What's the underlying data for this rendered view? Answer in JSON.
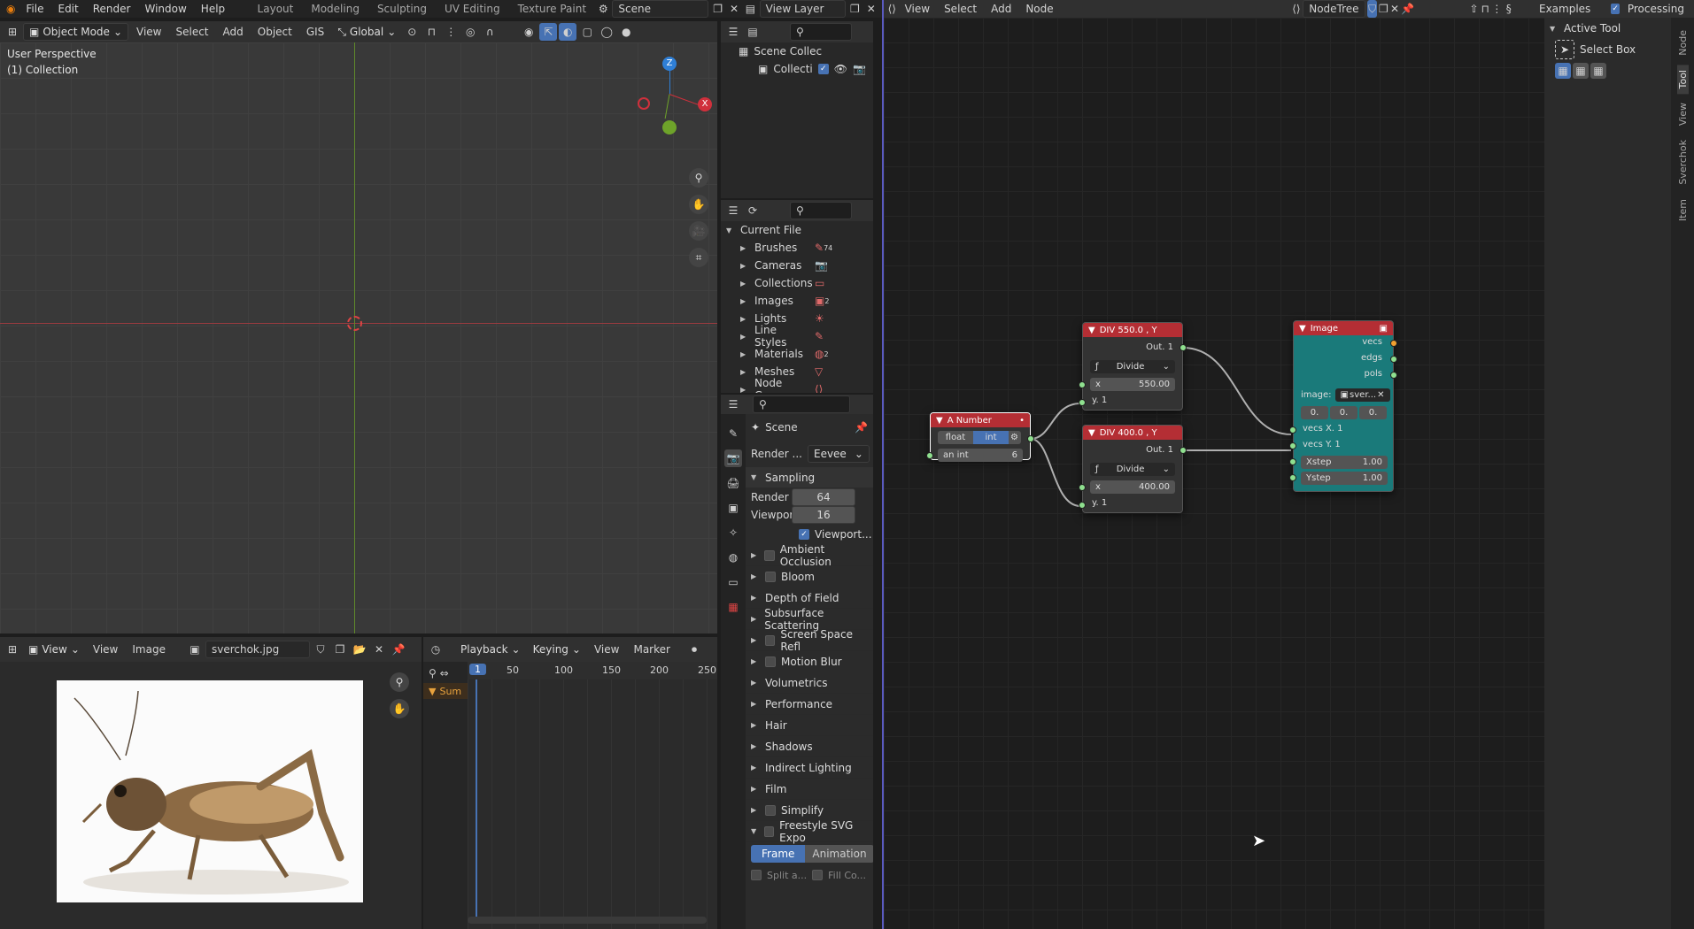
{
  "topbar": {
    "menus": [
      "File",
      "Edit",
      "Render",
      "Window",
      "Help"
    ],
    "workspaces": [
      "Layout",
      "Modeling",
      "Sculpting",
      "UV Editing",
      "Texture Paint"
    ],
    "active_workspace": "Layout",
    "scene": "Scene",
    "view_layer": "View Layer"
  },
  "viewport": {
    "mode": "Object Mode",
    "menus": [
      "View",
      "Select",
      "Add",
      "Object",
      "GIS"
    ],
    "orientation": "Global",
    "overlay_title": "User Perspective",
    "overlay_collection": "(1) Collection",
    "gizmo": {
      "z": "Z",
      "y": "Y",
      "x": "X"
    },
    "colors": {
      "x_axis": "#d0303c",
      "y_axis": "#6ea32a",
      "z_axis": "#2f7fd6"
    }
  },
  "outliner": {
    "scene_collection": "Scene Collec",
    "collection": "Collecti"
  },
  "file_browser": {
    "root": "Current File",
    "items": [
      {
        "label": "Brushes",
        "icon": "brush-icon",
        "count": "74"
      },
      {
        "label": "Cameras",
        "icon": "camera-icon",
        "count": ""
      },
      {
        "label": "Collections",
        "icon": "collection-icon",
        "count": ""
      },
      {
        "label": "Images",
        "icon": "image-icon",
        "count": "2"
      },
      {
        "label": "Lights",
        "icon": "light-icon",
        "count": ""
      },
      {
        "label": "Line Styles",
        "icon": "linestyle-icon",
        "count": ""
      },
      {
        "label": "Materials",
        "icon": "material-icon",
        "count": "2"
      },
      {
        "label": "Meshes",
        "icon": "mesh-icon",
        "count": ""
      },
      {
        "label": "Node Groups",
        "icon": "nodegroup-icon",
        "count": ""
      }
    ]
  },
  "properties": {
    "scene": "Scene",
    "render_label": "Render ...",
    "render_engine": "Eevee",
    "sampling": {
      "title": "Sampling",
      "render_label": "Render",
      "render_value": "64",
      "viewport_label": "Viewport",
      "viewport_value": "16",
      "denoise_label": "Viewport..."
    },
    "panels": [
      {
        "label": "Ambient Occlusion",
        "checkbox": true
      },
      {
        "label": "Bloom",
        "checkbox": true
      },
      {
        "label": "Depth of Field",
        "checkbox": false
      },
      {
        "label": "Subsurface Scattering",
        "checkbox": false
      },
      {
        "label": "Screen Space Refl",
        "checkbox": true
      },
      {
        "label": "Motion Blur",
        "checkbox": true
      },
      {
        "label": "Volumetrics",
        "checkbox": false
      },
      {
        "label": "Performance",
        "checkbox": false
      },
      {
        "label": "Hair",
        "checkbox": false
      },
      {
        "label": "Shadows",
        "checkbox": false
      },
      {
        "label": "Indirect Lighting",
        "checkbox": false
      },
      {
        "label": "Film",
        "checkbox": false
      },
      {
        "label": "Simplify",
        "checkbox": true
      }
    ],
    "freestyle": "Freestyle SVG Expo",
    "freestyle_tabs": [
      "Frame",
      "Animation"
    ],
    "freestyle_opts": [
      "Split a...",
      "Fill Co..."
    ]
  },
  "image_editor": {
    "menus": [
      "View",
      "View",
      "Image"
    ],
    "image_name": "sverchok.jpg"
  },
  "timeline": {
    "menus": [
      "Playback",
      "Keying",
      "View",
      "Marker"
    ],
    "current_frame": "1",
    "ticks": [
      "50",
      "100",
      "150",
      "200",
      "250"
    ],
    "summary": "Sum"
  },
  "node_editor": {
    "menus": [
      "View",
      "Select",
      "Add",
      "Node"
    ],
    "tree_name": "NodeTree",
    "right_menus": [
      "Examples",
      "Processing"
    ],
    "active_tool_title": "Active Tool",
    "active_tool": "Select Box",
    "side_tabs": [
      "Node",
      "Tool",
      "View",
      "Sverchok",
      "Item"
    ],
    "nodes": {
      "number": {
        "title": "A Number",
        "mode_a": "float",
        "mode_b": "int",
        "field_label": "an int",
        "field_value": "6"
      },
      "div1": {
        "title": "DIV 550.0 , Y",
        "out": "Out. 1",
        "op": "Divide",
        "x_label": "x",
        "x_value": "550.00",
        "y_label": "y. 1"
      },
      "div2": {
        "title": "DIV 400.0 , Y",
        "out": "Out. 1",
        "op": "Divide",
        "x_label": "x",
        "x_value": "400.00",
        "y_label": "y. 1"
      },
      "image": {
        "title": "Image",
        "outs": [
          "vecs",
          "edgs",
          "pols"
        ],
        "image_label": "image:",
        "image_value": "sver...",
        "vec": [
          "0.",
          "0.",
          "0."
        ],
        "in1": "vecs X. 1",
        "in2": "vecs Y. 1",
        "xstep_label": "Xstep",
        "xstep_value": "1.00",
        "ystep_label": "Ystep",
        "ystep_value": "1.00"
      }
    }
  }
}
